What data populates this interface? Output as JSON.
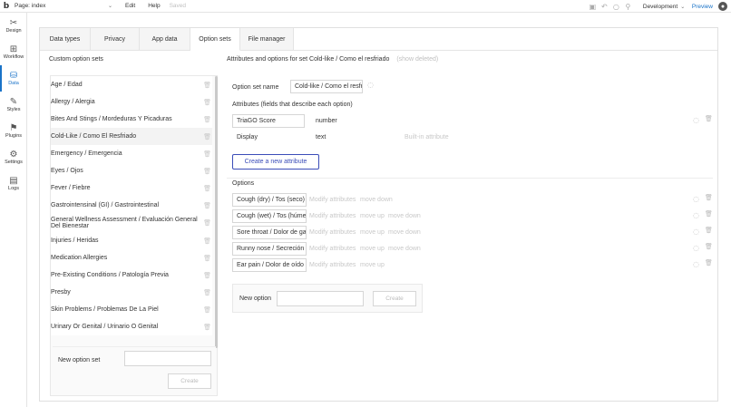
{
  "topbar": {
    "logo": "b",
    "page_label": "Page: index",
    "menu": [
      "Edit",
      "Help"
    ],
    "saved_text": "Saved",
    "environment": "Development",
    "preview": "Preview"
  },
  "leftnav": [
    {
      "label": "Design",
      "icon": "design-icon",
      "active": false
    },
    {
      "label": "Workflow",
      "icon": "workflow-icon",
      "active": false
    },
    {
      "label": "Data",
      "icon": "database-icon",
      "active": true
    },
    {
      "label": "Styles",
      "icon": "brush-icon",
      "active": false
    },
    {
      "label": "Plugins",
      "icon": "plugin-icon",
      "active": false
    },
    {
      "label": "Settings",
      "icon": "gear-icon",
      "active": false
    },
    {
      "label": "Logs",
      "icon": "document-icon",
      "active": false
    }
  ],
  "tabs": [
    {
      "label": "Data types",
      "active": false
    },
    {
      "label": "Privacy",
      "active": false
    },
    {
      "label": "App data",
      "active": false
    },
    {
      "label": "Option sets",
      "active": true
    },
    {
      "label": "File manager",
      "active": false
    }
  ],
  "option_sets": {
    "title": "Custom option sets",
    "items": [
      {
        "label": "Age / Edad"
      },
      {
        "label": "Allergy / Alergia"
      },
      {
        "label": "Bites And Stings / Mordeduras Y Picaduras"
      },
      {
        "label": "Cold-Like / Como El Resfriado",
        "selected": true
      },
      {
        "label": "Emergency / Emergencia"
      },
      {
        "label": "Eyes / Ojos"
      },
      {
        "label": "Fever / Fiebre"
      },
      {
        "label": "Gastrointensinal (GI) / Gastrointestinal"
      },
      {
        "label": "General Wellness Assessment / Evaluación General Del Bienestar"
      },
      {
        "label": "Injuries / Heridas"
      },
      {
        "label": "Medication Allergies"
      },
      {
        "label": "Pre-Existing Conditions / Patología Previa"
      },
      {
        "label": "Presby"
      },
      {
        "label": "Skin Problems / Problemas De La Piel"
      },
      {
        "label": "Urinary Or Genital / Urinario O Genital"
      }
    ],
    "new_label": "New option set",
    "new_placeholder": "",
    "create": "Create"
  },
  "detail": {
    "title": "Attributes and options for set Cold-like / Como el resfriado",
    "show_deleted": "(show deleted)",
    "name_label": "Option set name",
    "name_value": "Cold-like / Como el resfriado",
    "attributes_label": "Attributes (fields that describe each option)",
    "attributes": [
      {
        "name": "TriaGO Score",
        "type": "number",
        "builtin": "",
        "editable": true
      },
      {
        "name": "Display",
        "type": "text",
        "builtin": "Built-in attribute",
        "editable": false
      }
    ],
    "create_attribute": "Create a new attribute",
    "options_label": "Options",
    "options": [
      {
        "name": "Cough (dry) / Tos (seco)",
        "actions": [
          "Modify attributes",
          "move down"
        ]
      },
      {
        "name": "Cough (wet) / Tos (húmedo)",
        "actions": [
          "Modify attributes",
          "move up",
          "move down"
        ]
      },
      {
        "name": "Sore throat / Dolor de garganta",
        "actions": [
          "Modify attributes",
          "move up",
          "move down"
        ]
      },
      {
        "name": "Runny nose / Secreción nasal",
        "actions": [
          "Modify attributes",
          "move up",
          "move down"
        ]
      },
      {
        "name": "Ear pain / Dolor de oído",
        "actions": [
          "Modify attributes",
          "move up"
        ]
      }
    ],
    "new_option_label": "New option",
    "new_option_create": "Create"
  }
}
